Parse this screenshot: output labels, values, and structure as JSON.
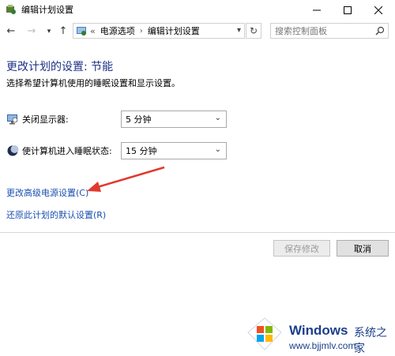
{
  "window": {
    "title": "编辑计划设置"
  },
  "nav": {
    "back_glyph": "←",
    "forward_glyph": "→",
    "recent_glyph": "▾",
    "up_glyph": "↑",
    "address_prefix": "«",
    "breadcrumbs": [
      "电源选项",
      "编辑计划设置"
    ],
    "breadcrumb_separator": "›",
    "refresh_glyph": "↻",
    "search_placeholder": "搜索控制面板"
  },
  "content": {
    "heading": "更改计划的设置: 节能",
    "subtext": "选择希望计算机使用的睡眠设置和显示设置。",
    "display_off": {
      "label": "关闭显示器:",
      "value": "5 分钟"
    },
    "sleep": {
      "label": "使计算机进入睡眠状态:",
      "value": "15 分钟"
    },
    "link_advanced": "更改高级电源设置(C)",
    "link_restore": "还原此计划的默认设置(R)"
  },
  "buttons": {
    "save": "保存修改",
    "cancel": "取消"
  },
  "watermark": {
    "brand": "Windows",
    "brand_suffix": "系统之家",
    "url": "www.bjjmlv.com"
  },
  "colors": {
    "heading": "#1e3287",
    "link": "#1a4fb0",
    "annotation_arrow": "#e03a2f"
  }
}
